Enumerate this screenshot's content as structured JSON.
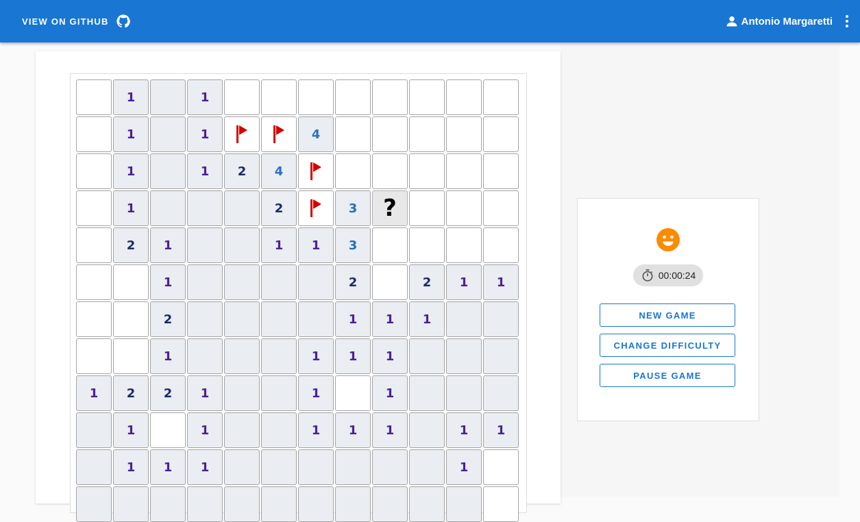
{
  "header": {
    "github_label": "VIEW ON GITHUB",
    "user_name": "Antonio Margaretti"
  },
  "game": {
    "timer": "00:00:24",
    "status_icon": "smiley-face-icon",
    "buttons": {
      "new_game": "NEW GAME",
      "change_difficulty": "CHANGE DIFFICULTY",
      "pause_game": "PAUSE GAME"
    }
  },
  "colors": {
    "app_bar": "#1976d2",
    "flag": "#d50000",
    "smiley": "#fb8c00",
    "number_1": "#4a2296",
    "number_2": "#1d2a6b",
    "number_3": "#1f6fb8",
    "number_4": "#2b71c2"
  },
  "board": {
    "legend": "H = hidden, E = revealed empty, F = flag, Q = question mark, digits = revealed count",
    "rows": [
      [
        "H",
        "1",
        "E",
        "1",
        "H",
        "H",
        "H",
        "H",
        "H",
        "H",
        "H",
        "H"
      ],
      [
        "H",
        "1",
        "E",
        "1",
        "F",
        "F",
        "4",
        "H",
        "H",
        "H",
        "H",
        "H"
      ],
      [
        "H",
        "1",
        "E",
        "1",
        "2",
        "4",
        "F",
        "H",
        "H",
        "H",
        "H",
        "H"
      ],
      [
        "H",
        "1",
        "E",
        "E",
        "E",
        "2",
        "F",
        "3",
        "Q",
        "H",
        "H",
        "H"
      ],
      [
        "H",
        "2",
        "1",
        "E",
        "E",
        "1",
        "1",
        "3",
        "H",
        "H",
        "H",
        "H"
      ],
      [
        "H",
        "H",
        "1",
        "E",
        "E",
        "E",
        "E",
        "2",
        "H",
        "2",
        "1",
        "1"
      ],
      [
        "H",
        "H",
        "2",
        "E",
        "E",
        "E",
        "E",
        "1",
        "1",
        "1",
        "E",
        "E"
      ],
      [
        "H",
        "H",
        "1",
        "E",
        "E",
        "E",
        "1",
        "1",
        "1",
        "E",
        "E",
        "E"
      ],
      [
        "1",
        "2",
        "2",
        "1",
        "E",
        "E",
        "1",
        "H",
        "1",
        "E",
        "E",
        "E"
      ],
      [
        "E",
        "1",
        "H",
        "1",
        "E",
        "E",
        "1",
        "1",
        "1",
        "E",
        "1",
        "1"
      ],
      [
        "E",
        "1",
        "1",
        "1",
        "E",
        "E",
        "E",
        "E",
        "E",
        "E",
        "1",
        "H"
      ],
      [
        "E",
        "E",
        "E",
        "E",
        "E",
        "E",
        "E",
        "E",
        "E",
        "E",
        "E",
        "H"
      ]
    ]
  }
}
